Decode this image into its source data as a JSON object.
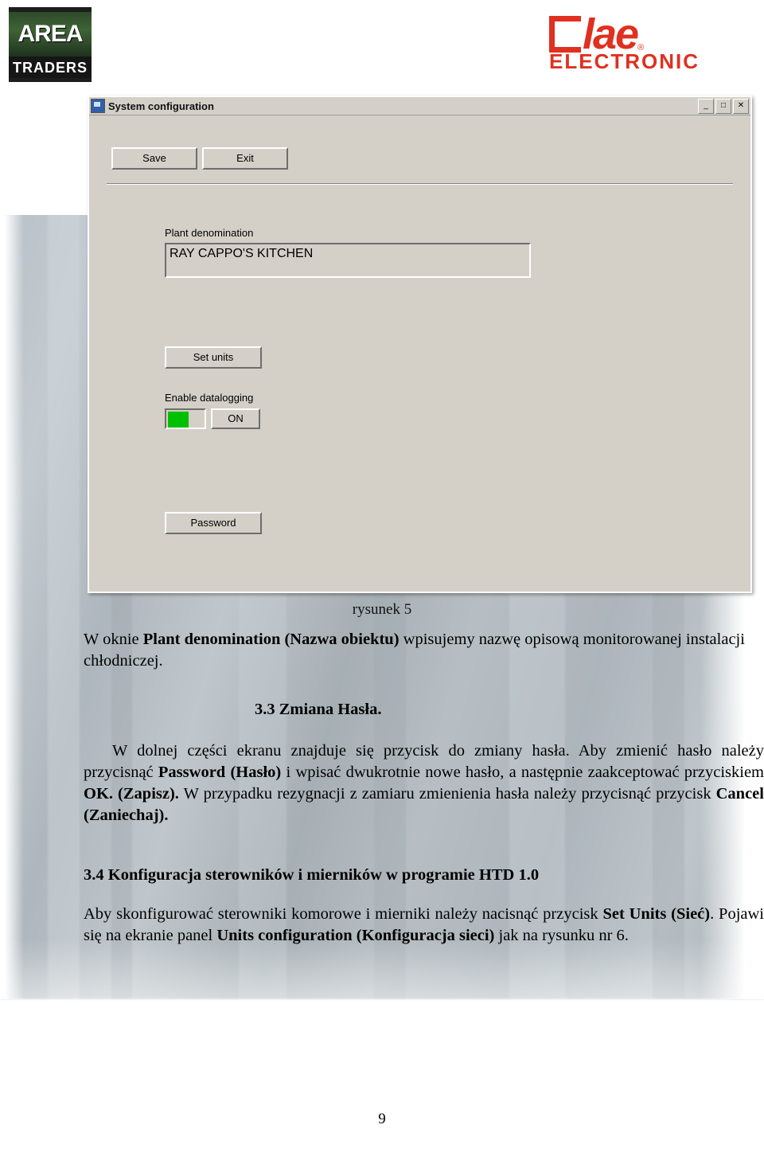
{
  "branding": {
    "area_logo": {
      "line1": "AREA",
      "line2": "TRADERS"
    },
    "lae_logo": {
      "word": "lae",
      "registered": "®",
      "sub": "ELECTRONIC"
    }
  },
  "dialog": {
    "title": "System configuration",
    "window_buttons": {
      "minimize": "_",
      "maximize": "□",
      "close": "✕"
    },
    "toolbar": {
      "save_label": "Save",
      "exit_label": "Exit"
    },
    "plant": {
      "label": "Plant denomination",
      "value": "RAY CAPPO'S KITCHEN",
      "placeholder": ""
    },
    "set_units_label": "Set units",
    "datalogging": {
      "label": "Enable datalogging",
      "state_label": "ON",
      "led_color": "#00c000"
    },
    "password_label": "Password"
  },
  "caption": "rysunek 5",
  "body": {
    "p1_a": "W oknie ",
    "p1_b": "Plant denomination (Nazwa obiektu)",
    "p1_c": " wpisujemy nazwę opisową monitorowanej instalacji chłodniczej.",
    "heading_33": "3.3 Zmiana Hasła.",
    "p2_a": "W dolnej części ekranu znajduje się przycisk do zmiany hasła. Aby zmienić hasło należy przycisnąć ",
    "p2_b": "Password (Hasło)",
    "p2_c": " i wpisać dwukrotnie nowe hasło, a następnie zaakceptować przyciskiem ",
    "p2_d": "OK. (Zapisz).",
    "p2_e": " W przypadku rezygnacji z zamiaru zmienienia hasła należy przycisnąć przycisk ",
    "p2_f": "Cancel (Zaniechaj).",
    "heading_34": "3.4 Konfiguracja sterowników i mierników w programie HTD 1.0",
    "p3_a": "Aby  skonfigurować  sterowniki  komorowe  i  mierniki  należy  nacisnąć  przycisk  ",
    "p3_b": "Set  Units (Sieć)",
    "p3_c": ". Pojawi się na ekranie panel ",
    "p3_d": "Units configuration (Konfiguracja sieci)",
    "p3_e": " jak na rysunku nr 6."
  },
  "page_number": "9"
}
